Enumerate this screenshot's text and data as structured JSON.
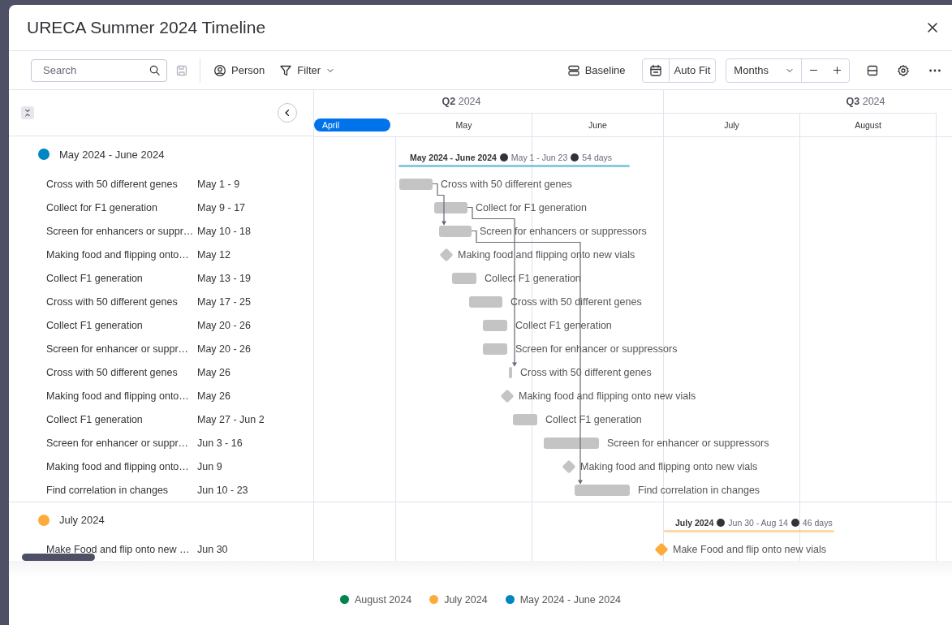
{
  "window": {
    "title": "URECA Summer 2024 Timeline"
  },
  "toolbar": {
    "search": {
      "placeholder": "Search"
    },
    "save_disabled": true,
    "person": "Person",
    "filter": "Filter",
    "baseline": "Baseline",
    "auto_fit": "Auto Fit",
    "zoom_unit": "Months"
  },
  "timeline": {
    "quarters": [
      {
        "label": "**Q2** 2024"
      },
      {
        "label": "**Q3** 2024"
      }
    ],
    "months": [
      {
        "label": "April",
        "current": true
      },
      {
        "label": "May",
        "current": false
      },
      {
        "label": "June",
        "current": false
      },
      {
        "label": "July",
        "current": false
      },
      {
        "label": "August",
        "current": false
      }
    ]
  },
  "groups": [
    {
      "name": "May 2024 - June 2024",
      "color": "#0086c0",
      "summary_title": "May 2024 - June 2024",
      "range": "May 1 - Jun 23",
      "duration": "54 days",
      "tasks": [
        {
          "name": "Cross with 50 different genes",
          "dates": "May 1 - 9",
          "bar_label": "Cross with 50 different genes",
          "kind": "bar",
          "color": "#c4c4c4"
        },
        {
          "name": "Collect for F1 generation",
          "dates": "May 9 - 17",
          "bar_label": "Collect for F1 generation",
          "kind": "bar",
          "color": "#c4c4c4"
        },
        {
          "name": "Screen for enhancers or suppr…",
          "dates": "May 10 - 18",
          "bar_label": "Screen for enhancers or suppressors",
          "kind": "bar",
          "color": "#c4c4c4"
        },
        {
          "name": "Making food and flipping onto…",
          "dates": "May 12",
          "bar_label": "Making food and flipping onto new vials",
          "kind": "milestone",
          "color": "#c4c4c4"
        },
        {
          "name": "Collect F1 generation",
          "dates": "May 13 - 19",
          "bar_label": "Collect F1 generation",
          "kind": "bar",
          "color": "#c4c4c4"
        },
        {
          "name": "Cross with 50 different genes",
          "dates": "May 17 - 25",
          "bar_label": "Cross with 50 different genes",
          "kind": "bar",
          "color": "#c4c4c4"
        },
        {
          "name": "Collect F1 generation",
          "dates": "May 20 - 26",
          "bar_label": "Collect F1 generation",
          "kind": "bar",
          "color": "#c4c4c4"
        },
        {
          "name": "Screen for enhancer or suppr…",
          "dates": "May 20 - 26",
          "bar_label": "Screen for enhancer or suppressors",
          "kind": "bar",
          "color": "#c4c4c4"
        },
        {
          "name": "Cross with 50 different genes",
          "dates": "May 26",
          "bar_label": "Cross with 50 different genes",
          "kind": "bar",
          "color": "#c4c4c4"
        },
        {
          "name": "Making food and flipping onto…",
          "dates": "May 26",
          "bar_label": "Making food and flipping onto new vials",
          "kind": "milestone",
          "color": "#c4c4c4"
        },
        {
          "name": "Collect F1 generation",
          "dates": "May 27 - Jun 2",
          "bar_label": "Collect F1 generation",
          "kind": "bar",
          "color": "#c4c4c4"
        },
        {
          "name": "Screen for enhancer or suppr…",
          "dates": "Jun 3 - 16",
          "bar_label": "Screen for enhancer or suppressors",
          "kind": "bar",
          "color": "#c4c4c4"
        },
        {
          "name": "Making food and flipping onto…",
          "dates": "Jun 9",
          "bar_label": "Making food and flipping onto new vials",
          "kind": "milestone",
          "color": "#c4c4c4"
        },
        {
          "name": "Find correlation in changes",
          "dates": "Jun 10 - 23",
          "bar_label": "Find correlation in changes",
          "kind": "bar",
          "color": "#c4c4c4"
        }
      ]
    },
    {
      "name": "July 2024",
      "color": "#fdab3d",
      "summary_title": "July 2024",
      "range": "Jun 30 - Aug 14",
      "duration": "46 days",
      "tasks": [
        {
          "name": "Make Food and flip onto new …",
          "dates": "Jun 30",
          "bar_label": "Make Food and flip onto new vials",
          "kind": "milestone",
          "color": "#fdab3d"
        }
      ]
    }
  ],
  "legend": [
    {
      "label": "August 2024",
      "color": "#00854d"
    },
    {
      "label": "July 2024",
      "color": "#fdab3d"
    },
    {
      "label": "May 2024 - June 2024",
      "color": "#0086c0"
    }
  ]
}
